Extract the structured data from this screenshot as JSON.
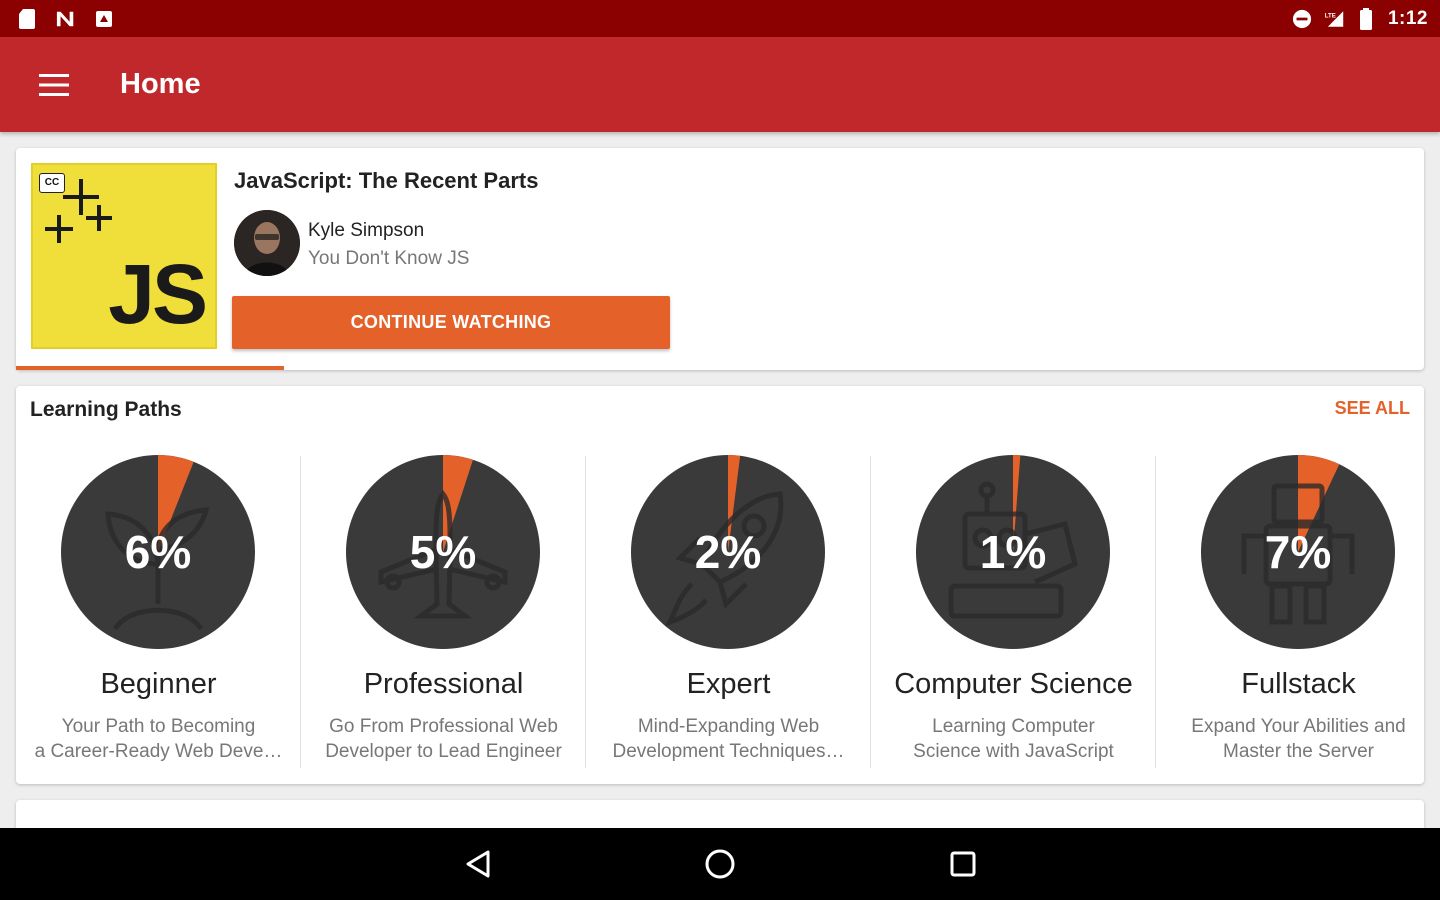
{
  "status_bar": {
    "time": "1:12",
    "left_icons": [
      "sd-card-icon",
      "n-icon",
      "app-icon"
    ],
    "right_icons": [
      "do-not-disturb-icon",
      "signal-lte-icon",
      "battery-icon"
    ]
  },
  "app_bar": {
    "title": "Home",
    "menu_icon": "hamburger-menu-icon",
    "color": "#c0282b"
  },
  "course": {
    "title": "JavaScript: The Recent Parts",
    "thumbnail_text": "JS",
    "thumbnail_badge": "CC",
    "instructor_name": "Kyle Simpson",
    "instructor_subtitle": "You Don't Know JS",
    "continue_label": "CONTINUE WATCHING",
    "progress_fraction": 0.19,
    "accent": "#e4612a"
  },
  "learning_paths": {
    "title": "Learning Paths",
    "see_all_label": "SEE ALL",
    "items": [
      {
        "percent_label": "6%",
        "progress": 0.06,
        "name": "Beginner",
        "desc_line1": "Your Path to Becoming",
        "desc_line2": "a Career-Ready Web Deve…",
        "icon": "plant-icon"
      },
      {
        "percent_label": "5%",
        "progress": 0.05,
        "name": "Professional",
        "desc_line1": "Go From Professional Web",
        "desc_line2": "Developer to Lead Engineer",
        "icon": "airplane-icon"
      },
      {
        "percent_label": "2%",
        "progress": 0.02,
        "name": "Expert",
        "desc_line1": "Mind-Expanding Web",
        "desc_line2": "Development Techniques…",
        "icon": "rocket-icon"
      },
      {
        "percent_label": "1%",
        "progress": 0.01,
        "name": "Computer Science",
        "desc_line1": "Learning Computer",
        "desc_line2": "Science with JavaScript",
        "icon": "robot-arm-icon"
      },
      {
        "percent_label": "7%",
        "progress": 0.07,
        "name": "Fullstack",
        "desc_line1": "Expand Your Abilities and",
        "desc_line2": "Master the Server",
        "icon": "robot-icon"
      }
    ]
  },
  "nav_bar": {
    "buttons": [
      "back-icon",
      "home-icon",
      "recents-icon"
    ]
  },
  "colors": {
    "status_bar": "#8b0000",
    "pie_background": "#3a3a3a",
    "pie_progress": "#e4612a"
  }
}
